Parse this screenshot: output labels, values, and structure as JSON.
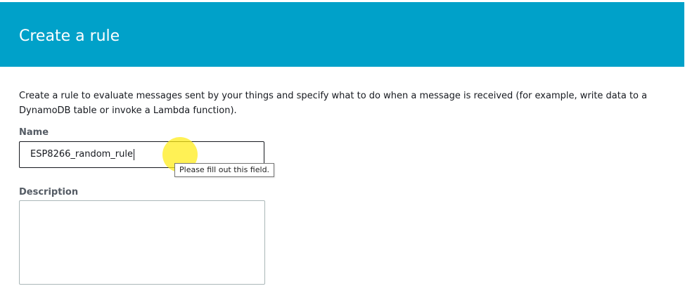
{
  "header": {
    "title": "Create a rule"
  },
  "intro": {
    "text": "Create a rule to evaluate messages sent by your things and specify what to do when a message is received (for example, write data to a DynamoDB table or invoke a Lambda function)."
  },
  "form": {
    "name": {
      "label": "Name",
      "value": "ESP8266_random_rule",
      "validation_tooltip": "Please fill out this field."
    },
    "description": {
      "label": "Description",
      "value": ""
    }
  },
  "colors": {
    "header_background": "#00a1c9",
    "cursor_highlight": "#ffec14"
  }
}
